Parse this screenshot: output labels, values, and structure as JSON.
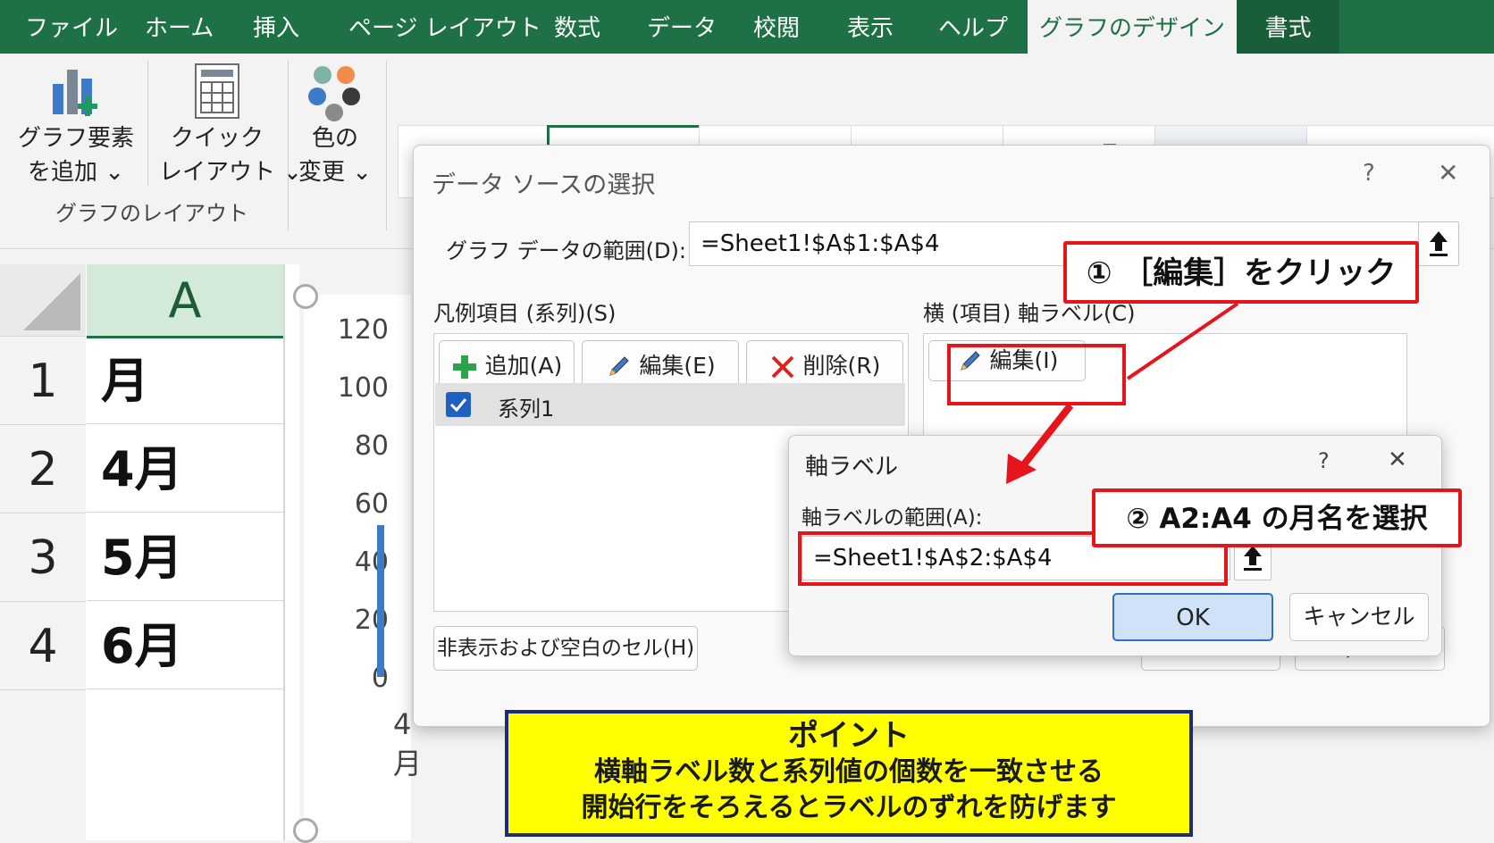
{
  "ribbon": {
    "tabs": [
      "ファイル",
      "ホーム",
      "挿入",
      "ページ レイアウト",
      "数式",
      "データ",
      "校閲",
      "表示",
      "ヘルプ",
      "グラフのデザイン",
      "書式"
    ],
    "add_element_label_1": "グラフ要素",
    "add_element_label_2": "を追加 ⌄",
    "quick_layout_label_1": "クイック",
    "quick_layout_label_2": "レイアウト ⌄",
    "change_color_label_1": "色の",
    "change_color_label_2": "変更 ⌄",
    "group_layout_label": "グラフのレイアウト"
  },
  "sheet": {
    "column_header": "A",
    "rows": [
      {
        "num": "1",
        "value": "月"
      },
      {
        "num": "2",
        "value": "4月"
      },
      {
        "num": "3",
        "value": "5月"
      },
      {
        "num": "4",
        "value": "6月"
      }
    ]
  },
  "chart": {
    "y_ticks": [
      "120",
      "100",
      "80",
      "60",
      "40",
      "20",
      "0"
    ],
    "x_first_label": "4月"
  },
  "select_data_dialog": {
    "title": "データ ソースの選択",
    "help": "?",
    "close": "✕",
    "range_label": "グラフ データの範囲(D):",
    "range_value": "=Sheet1!$A$1:$A$4",
    "legend_label": "凡例項目 (系列)(S)",
    "add_btn": "追加(A)",
    "edit_btn": "編集(E)",
    "delete_btn": "削除(R)",
    "series_item": "系列1",
    "axis_label_title": "横 (項目) 軸ラベル(C)",
    "axis_edit_btn": "編集(I)",
    "hidden_cells_btn": "非表示および空白のセル(H)",
    "ok": "OK",
    "cancel": "キャンセル"
  },
  "axis_dialog": {
    "title": "軸ラベル",
    "help": "?",
    "close": "✕",
    "range_label": "軸ラベルの範囲(A):",
    "range_value": "=Sheet1!$A$2:$A$4",
    "ok": "OK",
    "cancel": "キャンセル"
  },
  "annotations": {
    "step1": "① ［編集］をクリック",
    "step2": "② A2:A4 の月名を選択",
    "point_title": "ポイント",
    "point_line1": "横軸ラベル数と系列値の個数を一致させる",
    "point_line2": "開始行をそろえるとラベルのずれを防げます"
  },
  "colors": {
    "excel_green": "#1e7145",
    "callout_red": "#e8141b",
    "point_yellow": "#ffff00",
    "point_border": "#1d2a7a"
  }
}
